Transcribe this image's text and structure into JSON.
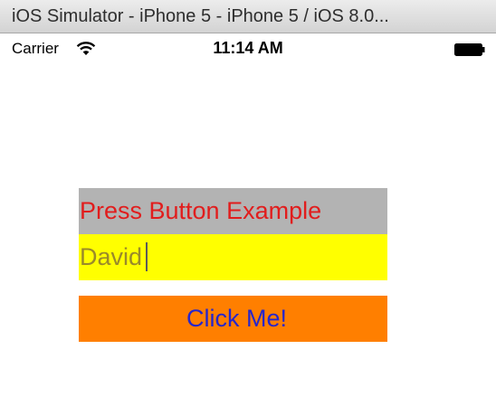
{
  "window": {
    "title": "iOS Simulator - iPhone 5 - iPhone 5 / iOS 8.0..."
  },
  "status_bar": {
    "carrier": "Carrier",
    "time": "11:14 AM",
    "wifi_icon": "wifi-icon",
    "battery_icon": "battery-icon"
  },
  "app": {
    "heading": "Press Button Example",
    "name_input": {
      "value": "David"
    },
    "button_label": "Click Me!"
  },
  "colors": {
    "heading_bg": "#b3b3b3",
    "heading_text": "#e11d1d",
    "input_bg": "#ffff00",
    "input_text": "#9a8a2a",
    "button_bg": "#ff7f00",
    "button_text": "#2626cc"
  }
}
